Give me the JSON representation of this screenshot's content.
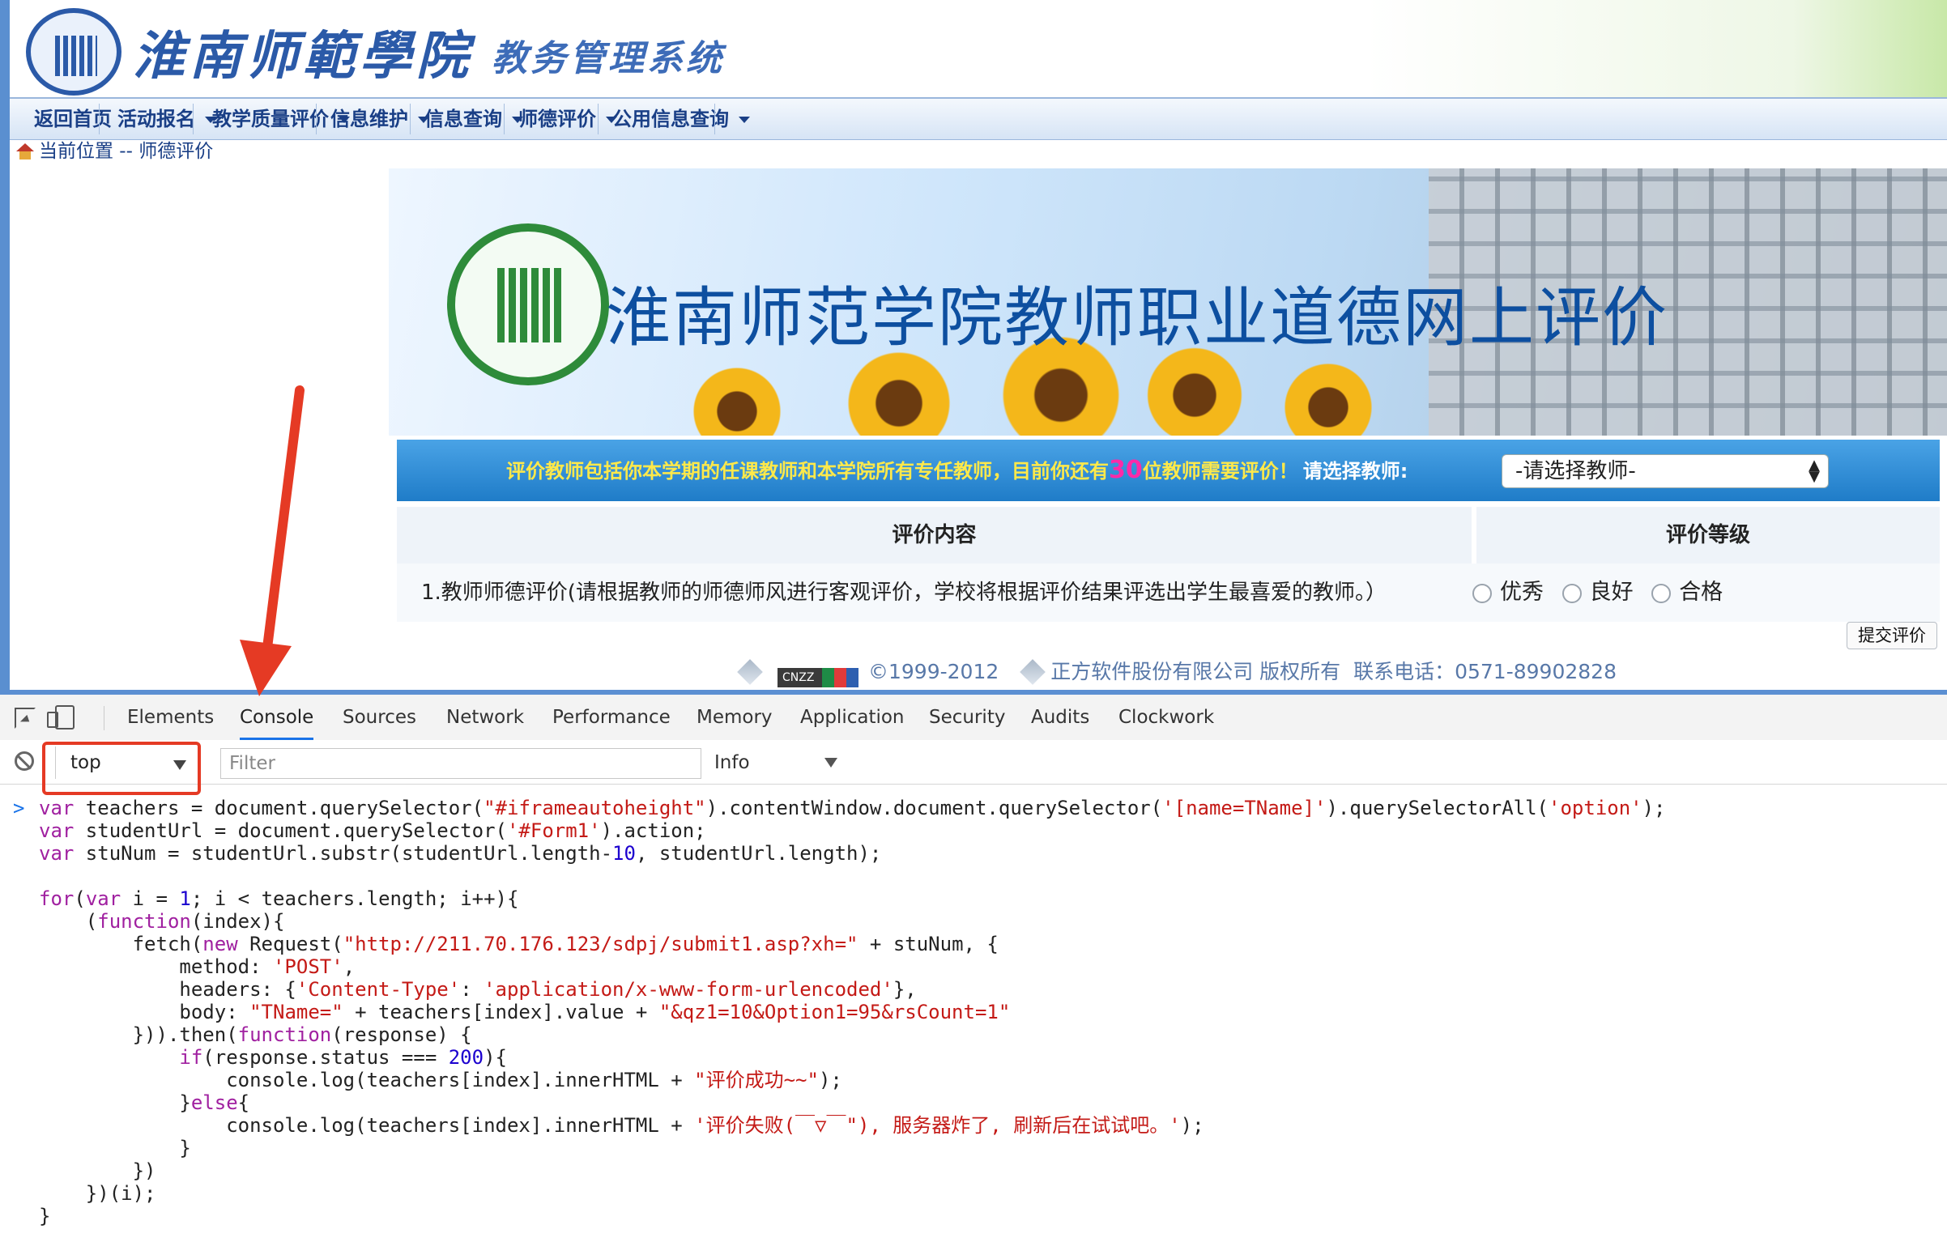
{
  "header": {
    "school_name": "淮南师範學院",
    "system_name": "教务管理系统"
  },
  "nav": {
    "items": [
      {
        "label": "返回首页",
        "dropdown": false
      },
      {
        "label": "活动报名",
        "dropdown": true
      },
      {
        "label": "教学质量评价",
        "dropdown": true
      },
      {
        "label": "信息维护",
        "dropdown": true
      },
      {
        "label": "信息查询",
        "dropdown": true
      },
      {
        "label": "师德评价",
        "dropdown": true
      },
      {
        "label": "公用信息查询",
        "dropdown": true
      }
    ]
  },
  "breadcrumb": {
    "text": "当前位置 -- 师德评价"
  },
  "banner": {
    "title": "淮南师范学院教师职业道德网上评价"
  },
  "evaluation": {
    "notice_prefix": "评价教师包括你本学期的任课教师和本学院所有专任教师，目前你还有",
    "remaining_count": "30",
    "notice_suffix": "位教师需要评价！",
    "choose_label": "请选择教师:",
    "teacher_select_value": "-请选择教师-",
    "col_content": "评价内容",
    "col_grade": "评价等级",
    "question": "1.教师师德评价(请根据教师的师德师风进行客观评价，学校将根据评价结果评选出学生最喜爱的教师。）",
    "options": [
      "优秀",
      "良好",
      "合格"
    ],
    "submit_label": "提交评价"
  },
  "footer": {
    "badge": "CNZZ",
    "copyright": "©1999-2012",
    "company": "正方软件股份有限公司 版权所有",
    "phone": "联系电话：0571-89902828"
  },
  "devtools": {
    "tabs": [
      "Elements",
      "Console",
      "Sources",
      "Network",
      "Performance",
      "Memory",
      "Application",
      "Security",
      "Audits",
      "Clockwork"
    ],
    "active_tab": "Console",
    "context": "top",
    "filter_placeholder": "Filter",
    "level": "Info",
    "accent_color": "#1a73e8",
    "highlight_color": "#e53a24"
  },
  "console": {
    "code_lines": [
      "var teachers = document.querySelector(\"#iframeautoheight\").contentWindow.document.querySelector('[name=TName]').querySelectorAll('option');",
      "var studentUrl = document.querySelector('#Form1').action;",
      "var stuNum = studentUrl.substr(studentUrl.length-10, studentUrl.length);",
      "",
      "for(var i = 1; i < teachers.length; i++){",
      "    (function(index){",
      "        fetch(new Request(\"http://211.70.176.123/sdpj/submit1.asp?xh=\" + stuNum, {",
      "            method: 'POST',",
      "            headers: {'Content-Type': 'application/x-www-form-urlencoded'},",
      "            body: \"TName=\" + teachers[index].value + \"&qz1=10&Option1=95&rsCount=1\"",
      "        })).then(function(response) {",
      "            if(response.status === 200){",
      "                console.log(teachers[index].innerHTML + \"评价成功~~\");",
      "            }else{",
      "                console.log(teachers[index].innerHTML + '评价失败(￣▽￣\"), 服务器炸了, 刷新后在试试吧。');",
      "            }",
      "        })",
      "    })(i);",
      "}"
    ]
  }
}
